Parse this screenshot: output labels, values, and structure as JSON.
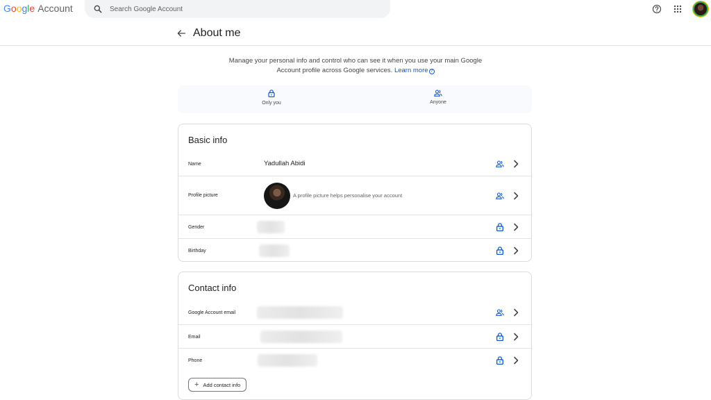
{
  "header": {
    "logo_google": [
      "G",
      "o",
      "o",
      "g",
      "l",
      "e"
    ],
    "logo_product": "Account",
    "search_placeholder": "Search Google Account"
  },
  "page": {
    "title": "About me",
    "intro_text": "Manage your personal info and control who can see it when you use your main Google Account profile across Google services.",
    "learn_more": "Learn more"
  },
  "legend": {
    "only_you": "Only you",
    "anyone": "Anyone"
  },
  "basic_info": {
    "title": "Basic info",
    "rows": [
      {
        "label": "Name",
        "value": "Yadullah Abidi",
        "visibility": "anyone"
      },
      {
        "label": "Profile picture",
        "value": "A profile picture helps personalise your account",
        "visibility": "anyone"
      },
      {
        "label": "Gender",
        "value": "",
        "visibility": "only-you"
      },
      {
        "label": "Birthday",
        "value": "",
        "visibility": "only-you"
      }
    ]
  },
  "contact_info": {
    "title": "Contact info",
    "rows": [
      {
        "label": "Google Account email",
        "value": "",
        "visibility": "anyone"
      },
      {
        "label": "Email",
        "value": "",
        "visibility": "only-you"
      },
      {
        "label": "Phone",
        "value": "",
        "visibility": "only-you"
      }
    ],
    "add_button": "Add contact info"
  },
  "colors": {
    "accent_blue": "#0b57d0",
    "text": "#202124",
    "muted": "#5f6368",
    "border": "#dadce0"
  },
  "icons": [
    "search-icon",
    "help-icon",
    "apps-grid-icon",
    "avatar",
    "back-arrow-icon",
    "lock-icon",
    "people-icon",
    "chevron-right-icon",
    "plus-icon",
    "info-icon"
  ]
}
